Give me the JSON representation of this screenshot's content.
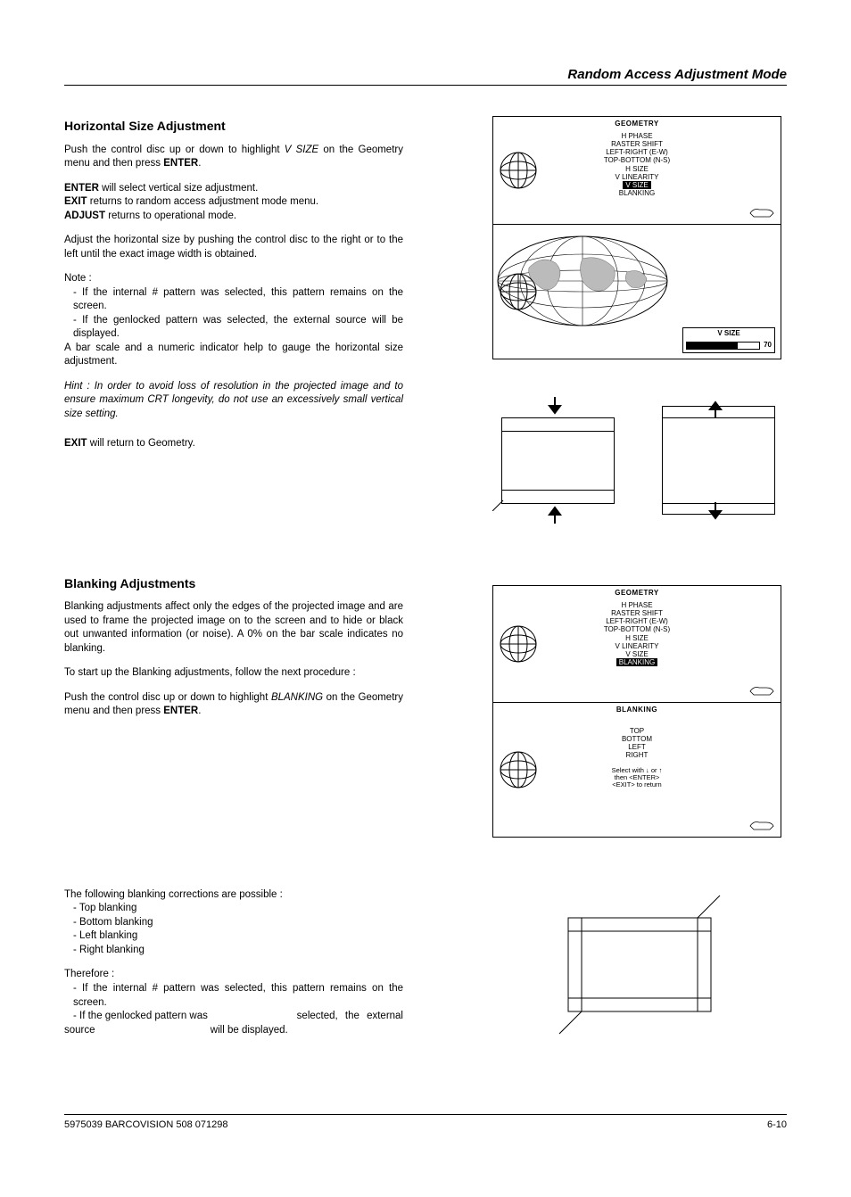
{
  "header": {
    "title_right": "Random Access Adjustment Mode"
  },
  "section1": {
    "heading": "Horizontal Size Adjustment",
    "p1a": "Push the control disc up or down to highlight ",
    "p1b": "V SIZE",
    "p1c": " on the Geometry menu and then press ",
    "p1d": "ENTER",
    "p1e": ".",
    "line_enter_bold": "ENTER",
    "line_enter_rest": " will select vertical size adjustment.",
    "line_exit_bold": "EXIT",
    "line_exit_rest": " returns to random access adjustment mode menu.",
    "line_adjust_bold": "ADJUST",
    "line_adjust_rest": " returns to operational mode.",
    "p2": "Adjust the horizontal size by pushing the control disc to the right or to the left until the exact image width is obtained.",
    "note_label": "Note  :",
    "note1": "- If the internal # pattern was selected, this pattern remains on the screen.",
    "note2": "- If the genlocked pattern was selected, the external source will be displayed.",
    "p3": "A bar scale and a numeric indicator help to gauge the horizontal size adjustment.",
    "hint": "Hint : In order to avoid loss of resolution in the projected image and to ensure maximum CRT longevity, do not use an excessively small vertical  size  setting.",
    "exit_line_bold": "EXIT",
    "exit_line_rest": " will return to Geometry."
  },
  "geometry_menu": {
    "title": "GEOMETRY",
    "items": [
      "H  PHASE",
      "RASTER  SHIFT",
      "LEFT-RIGHT  (E-W)",
      "TOP-BOTTOM  (N-S)",
      "H  SIZE",
      "V  LINEARITY",
      "V  SIZE",
      "BLANKING"
    ],
    "selected_vsize": "V  SIZE",
    "selected_blanking": "BLANKING"
  },
  "vsize_box": {
    "title": "V SIZE",
    "value": "70",
    "percent": 70
  },
  "section2": {
    "heading": "Blanking Adjustments",
    "p1": "Blanking adjustments affect only the edges of the projected image and are used to frame the projected image on to the screen and to hide or black out unwanted information (or noise).  A 0% on the bar scale indicates no blanking.",
    "p2": "To start up the Blanking adjustments, follow the next procedure :",
    "p3a": "Push the control disc up or down to highlight ",
    "p3b": "BLANKING",
    "p3c": " on the Geometry menu and then press ",
    "p3d": "ENTER",
    "p3e": ".",
    "p4": "The following blanking corrections are possible :",
    "bl1": "- Top blanking",
    "bl2": "- Bottom blanking",
    "bl3": "- Left blanking",
    "bl4": "- Right blanking",
    "therefore": "Therefore   :",
    "th1": "- If the internal # pattern was selected, this pattern remains on the screen.",
    "th2a": "- If the genlocked pattern was",
    "th2b": "selected,  the  external",
    "th3a": "source",
    "th3b": "will be displayed."
  },
  "blanking_menu": {
    "title": "BLANKING",
    "items": [
      "TOP",
      "BOTTOM",
      "LEFT",
      "RIGHT"
    ],
    "select_line1": "Select with  ↓   or ↑",
    "select_line2": "then  <ENTER>",
    "select_line3": "<EXIT>  to  return"
  },
  "footer": {
    "left": "5975039 BARCOVISION 508 071298",
    "right": "6-10"
  }
}
